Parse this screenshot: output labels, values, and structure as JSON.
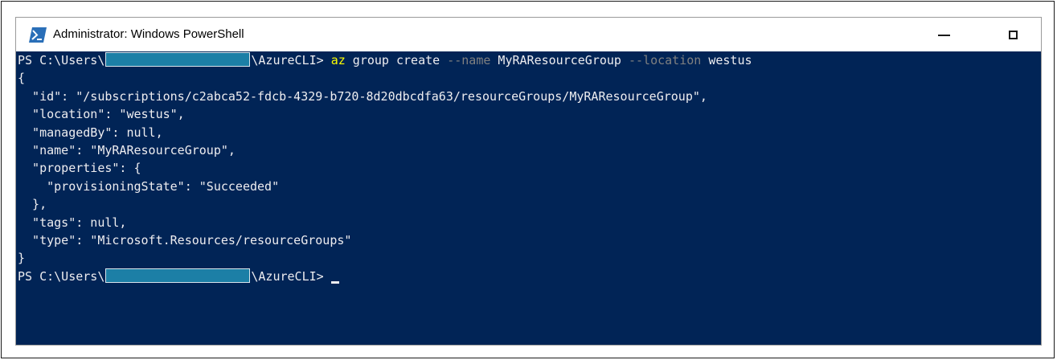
{
  "window": {
    "title": "Administrator: Windows PowerShell",
    "icon": "powershell-icon",
    "min_icon": "minimize-icon",
    "max_icon": "maximize-icon"
  },
  "colors": {
    "console_bg": "#012456",
    "console_fg": "#eeedf0",
    "command": "#ffff00",
    "parameter": "#808080",
    "redaction": "#1c7fa6"
  },
  "console": {
    "prompt_prefix": "PS C:\\Users\\",
    "prompt_suffix": "\\AzureCLI> ",
    "command": {
      "cmd": "az",
      "args1": " group create ",
      "param_name": "--name",
      "value_name": " MyRAResourceGroup ",
      "param_location": "--location",
      "value_location": " westus"
    },
    "output": [
      "{",
      "  \"id\": \"/subscriptions/c2abca52-fdcb-4329-b720-8d20dbcdfa63/resourceGroups/MyRAResourceGroup\",",
      "  \"location\": \"westus\",",
      "  \"managedBy\": null,",
      "  \"name\": \"MyRAResourceGroup\",",
      "  \"properties\": {",
      "    \"provisioningState\": \"Succeeded\"",
      "  },",
      "  \"tags\": null,",
      "  \"type\": \"Microsoft.Resources/resourceGroups\"",
      "}"
    ]
  }
}
